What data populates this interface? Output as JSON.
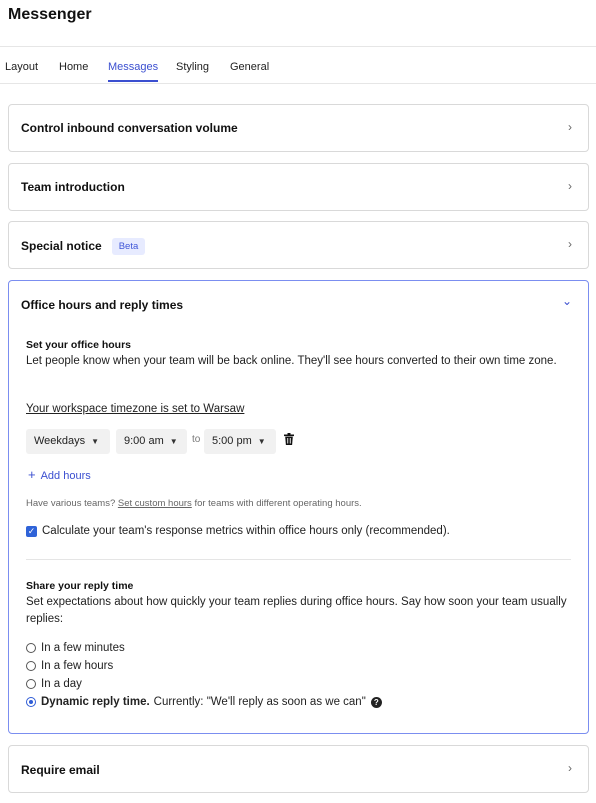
{
  "app": {
    "title": "Messenger"
  },
  "tabs": [
    "Layout",
    "Home",
    "Messages",
    "Styling",
    "General"
  ],
  "sections": {
    "inbound": {
      "title": "Control inbound conversation volume"
    },
    "team_intro": {
      "title": "Team introduction"
    },
    "special_notice": {
      "title": "Special notice",
      "badge": "Beta"
    },
    "office_hours": {
      "title": "Office hours and reply times",
      "set_hours_title": "Set your office hours",
      "set_hours_desc": "Let people know when your team will be back online. They'll see hours converted to their own time zone.",
      "timezone_link": "Your workspace timezone is set to Warsaw",
      "day_select": "Weekdays",
      "start_select": "9:00 am",
      "to_label": "to",
      "end_select": "5:00 pm",
      "add_hours": "Add hours",
      "custom_prefix": "Have various teams?",
      "custom_link": "Set custom hours",
      "custom_suffix": "for teams with different operating hours.",
      "metrics_checkbox": "Calculate your team's response metrics within office hours only (recommended).",
      "reply_title": "Share your reply time",
      "reply_desc": "Set expectations about how quickly your team replies during office hours. Say how soon your team usually replies:",
      "options": [
        "In a few minutes",
        "In a few hours",
        "In a day"
      ],
      "dynamic_bold": "Dynamic reply time.",
      "dynamic_rest": "Currently: \"We'll reply as soon as we can\""
    },
    "require_email": {
      "title": "Require email"
    }
  },
  "icons": {
    "chevron_right": "›",
    "chevron_down": "⌄",
    "caret": "▼",
    "plus": "+",
    "check": "✓",
    "help": "?"
  },
  "colors": {
    "accent": "#3b4fd0",
    "badge_bg": "#e7ebff",
    "open_border": "#7b8ef0"
  }
}
